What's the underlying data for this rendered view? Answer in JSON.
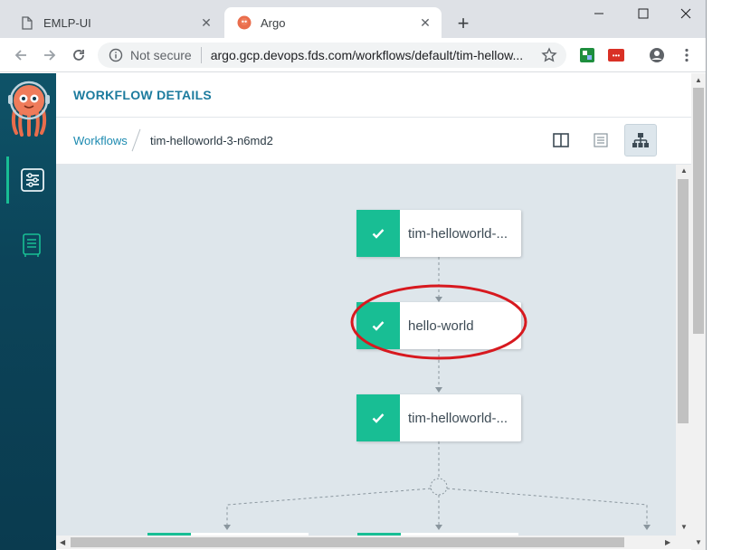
{
  "browser": {
    "tabs": [
      {
        "title": "EMLP-UI",
        "icon": "document-icon",
        "active": false
      },
      {
        "title": "Argo",
        "icon": "argo-favicon",
        "active": true
      }
    ],
    "newtab_symbol": "+",
    "close_symbol": "✕",
    "security_label": "Not secure",
    "url": "argo.gcp.devops.fds.com/workflows/default/tim-hellow...",
    "window_controls": [
      "minimize",
      "maximize",
      "close"
    ]
  },
  "sidebar": {
    "logo": "argo-octopus-logo",
    "items": [
      {
        "icon": "workflows-icon",
        "active": true
      },
      {
        "icon": "timeline-icon",
        "active": false
      }
    ]
  },
  "header": {
    "title": "WORKFLOW DETAILS"
  },
  "breadcrumbs": {
    "root": "Workflows",
    "current": "tim-helloworld-3-n6md2"
  },
  "view_toggles": [
    {
      "icon": "split-view-icon",
      "active": false
    },
    {
      "icon": "timeline-view-icon",
      "active": false
    },
    {
      "icon": "graph-view-icon",
      "active": true
    }
  ],
  "graph": {
    "nodes": [
      {
        "label": "tim-helloworld-...",
        "status": "succeeded"
      },
      {
        "label": "hello-world",
        "status": "succeeded"
      },
      {
        "label": "tim-helloworld-...",
        "status": "succeeded"
      }
    ],
    "highlight": "hello-world",
    "colors": {
      "success": "#18be94",
      "canvas": "#dee6eb",
      "annotation": "#d7191f"
    }
  }
}
